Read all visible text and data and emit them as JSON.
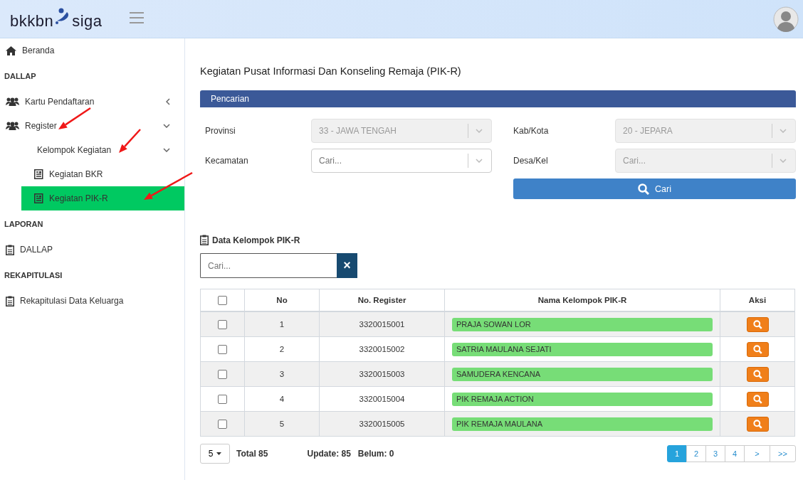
{
  "header": {
    "logo_left": "bkkbn",
    "logo_right": "siga"
  },
  "sidebar": {
    "items": [
      {
        "kind": "link",
        "label": "Beranda"
      },
      {
        "kind": "header",
        "label": "DALLAP"
      },
      {
        "kind": "group",
        "label": "Kartu Pendaftaran",
        "expanded": false
      },
      {
        "kind": "group",
        "label": "Register",
        "expanded": true,
        "children": [
          {
            "kind": "group",
            "label": "Kelompok Kegiatan",
            "expanded": true,
            "children": [
              {
                "kind": "link",
                "label": "Kegiatan BKR",
                "selected": false
              },
              {
                "kind": "link",
                "label": "Kegiatan PIK-R",
                "selected": true
              }
            ]
          }
        ]
      },
      {
        "kind": "header",
        "label": "LAPORAN"
      },
      {
        "kind": "link",
        "label": "DALLAP"
      },
      {
        "kind": "header",
        "label": "REKAPITULASI"
      },
      {
        "kind": "link",
        "label": "Rekapitulasi Data Keluarga"
      }
    ]
  },
  "page_title": "Kegiatan Pusat Informasi Dan Konseling Remaja (PIK-R)",
  "search_panel": {
    "title": "Pencarian",
    "fields": [
      {
        "label": "Provinsi",
        "value": "33 - JAWA TENGAH",
        "disabled": true
      },
      {
        "label": "Kab/Kota",
        "value": "20 - JEPARA",
        "disabled": true
      },
      {
        "label": "Kecamatan",
        "placeholder": "Cari...",
        "disabled": false
      },
      {
        "label": "Desa/Kel",
        "placeholder": "Cari...",
        "disabled": true
      }
    ],
    "button": "Cari"
  },
  "data_section": {
    "title": "Data Kelompok PIK-R",
    "search": {
      "placeholder": "Cari..."
    },
    "clear_button": "×"
  },
  "table": {
    "select_all_checked": false,
    "columns": [
      "No",
      "No. Register",
      "Nama Kelompok PIK-R",
      "Aksi"
    ],
    "rows": [
      {
        "checked": false,
        "no": "1",
        "register": "3320015001",
        "name": "PRAJA SOWAN LOR"
      },
      {
        "checked": false,
        "no": "2",
        "register": "3320015002",
        "name": "SATRIA MAULANA SEJATI"
      },
      {
        "checked": false,
        "no": "3",
        "register": "3320015003",
        "name": "SAMUDERA KENCANA"
      },
      {
        "checked": false,
        "no": "4",
        "register": "3320015004",
        "name": "PIK REMAJA ACTION"
      },
      {
        "checked": false,
        "no": "5",
        "register": "3320015005",
        "name": "PIK REMAJA MAULANA"
      }
    ]
  },
  "footer": {
    "page_size": "5",
    "total": "Total 85",
    "update": "Update: 85",
    "belum": "Belum: 0",
    "pages": [
      {
        "label": "1",
        "selected": true
      },
      {
        "label": "2",
        "selected": false
      },
      {
        "label": "3",
        "selected": false
      },
      {
        "label": "4",
        "selected": false
      },
      {
        "label": ">",
        "selected": false
      },
      {
        "label": ">>",
        "selected": false
      }
    ]
  }
}
